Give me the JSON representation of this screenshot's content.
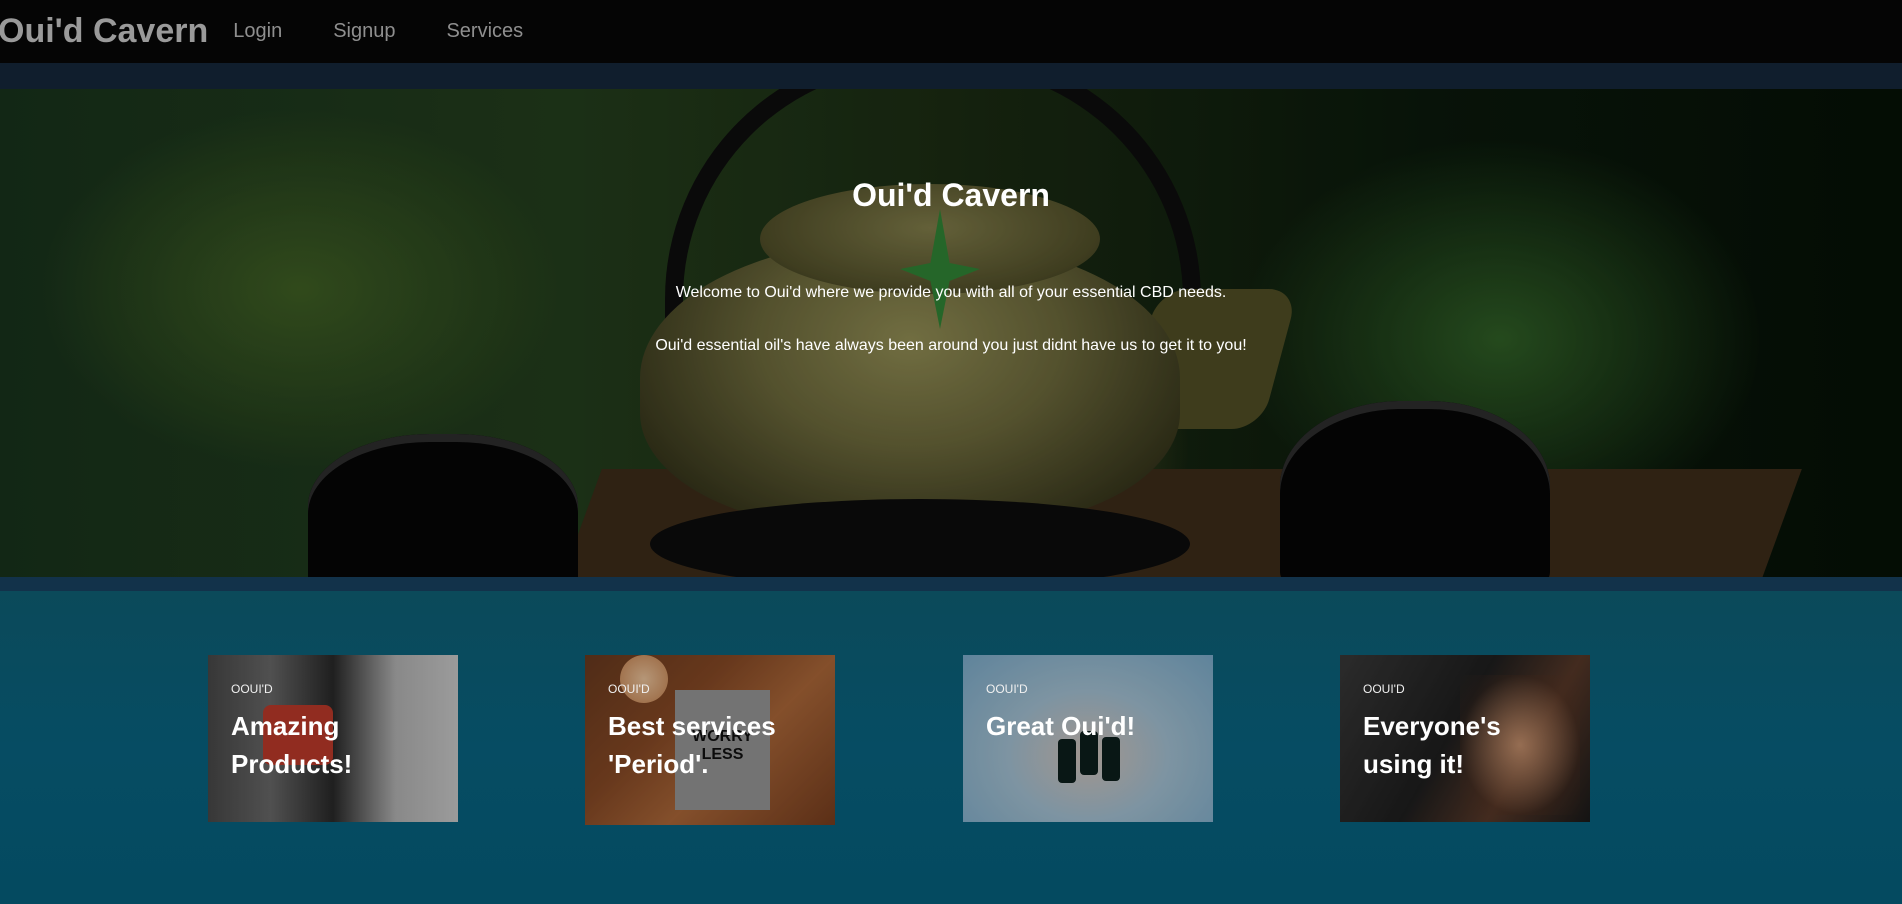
{
  "navbar": {
    "brand": "Oui'd Cavern",
    "links": [
      "Login",
      "Signup",
      "Services"
    ]
  },
  "hero": {
    "title": "Oui'd Cavern",
    "text1": "Welcome to Oui'd where we provide you with all of your essential CBD needs.",
    "text2": "Oui'd essential oil's have always been around you just didnt have us to get it to you!"
  },
  "cards": [
    {
      "kicker": "OOUI'D",
      "title": "Amazing Products!"
    },
    {
      "kicker": "OOUI'D",
      "title": "Best services 'Period'.",
      "image_text": "WORRY LESS"
    },
    {
      "kicker": "OOUI'D",
      "title": "Great Oui'd!"
    },
    {
      "kicker": "OOUI'D",
      "title": "Everyone's using it!"
    }
  ]
}
